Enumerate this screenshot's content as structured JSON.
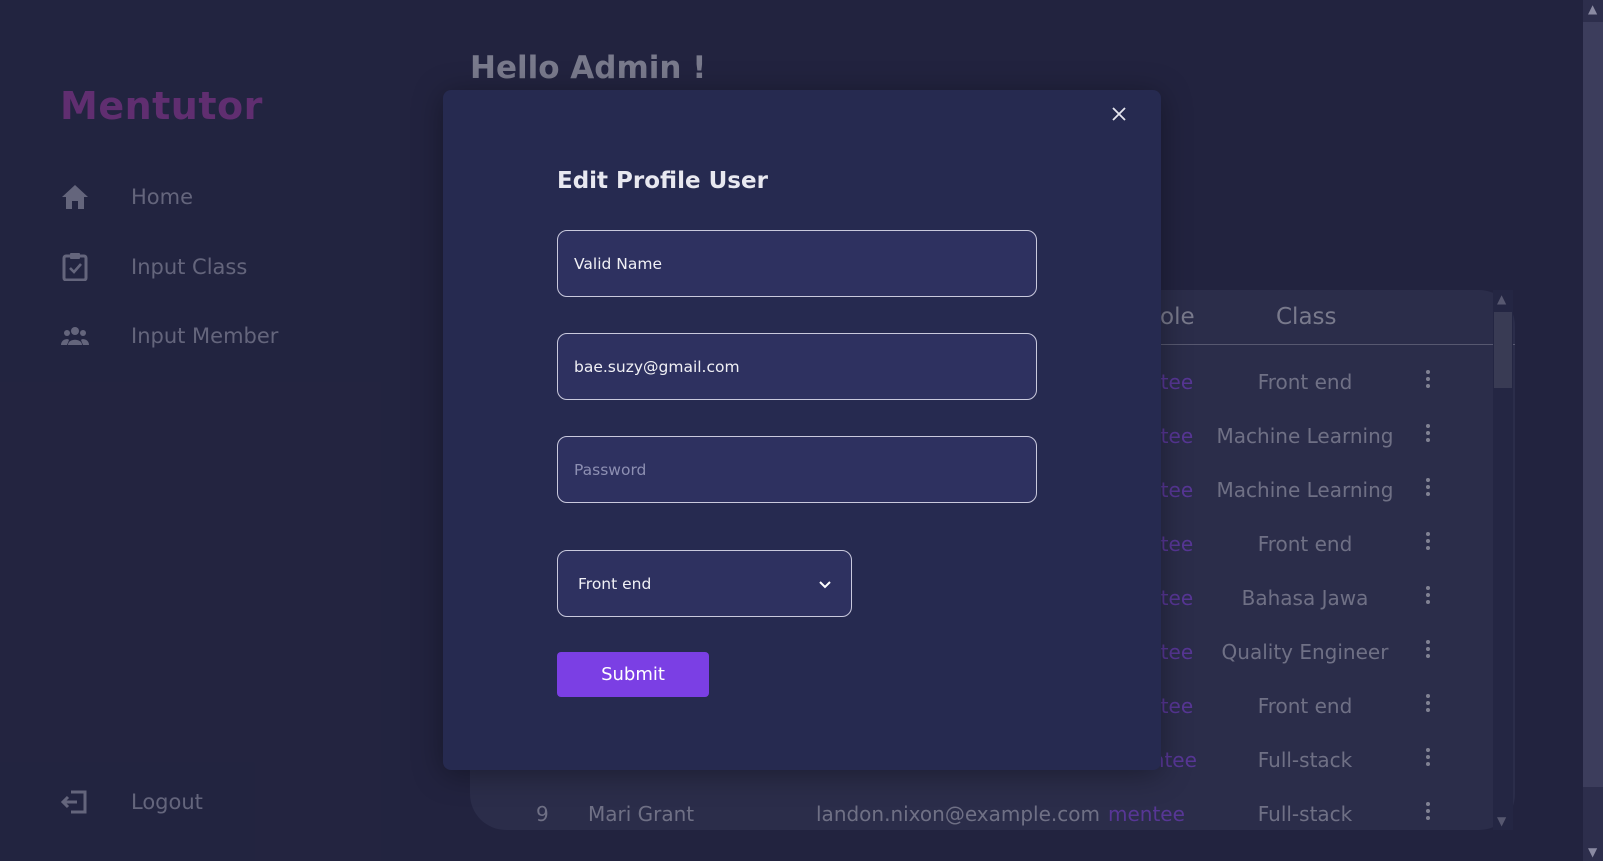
{
  "sidebar": {
    "brand": "Mentutor",
    "items": [
      {
        "label": "Home",
        "icon": "home-icon"
      },
      {
        "label": "Input Class",
        "icon": "clipboard-check-icon"
      },
      {
        "label": "Input Member",
        "icon": "users-icon"
      }
    ],
    "logout": {
      "label": "Logout",
      "icon": "logout-icon"
    }
  },
  "main": {
    "greeting": "Hello Admin !",
    "table": {
      "headers": {
        "role": "ole",
        "class": "Class"
      },
      "rows": [
        {
          "no": "",
          "name": "",
          "email": "",
          "role": "ntee",
          "class": "Front end"
        },
        {
          "no": "",
          "name": "",
          "email": "",
          "role": "ntee",
          "class": "Machine Learning"
        },
        {
          "no": "",
          "name": "",
          "email": "",
          "role": "ntee",
          "class": "Machine Learning"
        },
        {
          "no": "",
          "name": "",
          "email": "",
          "role": "ntee",
          "class": "Front end"
        },
        {
          "no": "",
          "name": "",
          "email": "",
          "role": "ntee",
          "class": "Bahasa Jawa"
        },
        {
          "no": "",
          "name": "",
          "email": "",
          "role": "ntee",
          "class": "Quality Engineer"
        },
        {
          "no": "",
          "name": "",
          "email": "",
          "role": "ntee",
          "class": "Front end"
        },
        {
          "no": "",
          "name": "",
          "email": "",
          "role": "mentee",
          "class": "Full-stack"
        },
        {
          "no": "9",
          "name": "Mari Grant",
          "email": "landon.nixon@example.com",
          "role": "mentee",
          "class": "Full-stack"
        }
      ]
    }
  },
  "modal": {
    "title": "Edit Profile User",
    "name_value": "Valid Name",
    "email_value": "bae.suzy@gmail.com",
    "password_placeholder": "Password",
    "class_selected": "Front end",
    "submit_label": "Submit"
  },
  "colors": {
    "background": "#2a2b4a",
    "brand": "#9b3fa3",
    "accent": "#7b3fe4",
    "role": "#8b4ee6",
    "modal": "#262a50"
  }
}
